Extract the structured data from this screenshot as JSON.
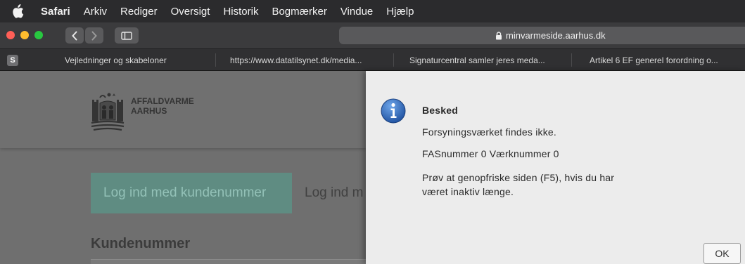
{
  "menubar": {
    "app": "Safari",
    "items": [
      "Arkiv",
      "Rediger",
      "Oversigt",
      "Historik",
      "Bogmærker",
      "Vindue",
      "Hjælp"
    ]
  },
  "toolbar": {
    "address": "minvarmeside.aarhus.dk"
  },
  "bookmarks": {
    "favicon_letter": "S",
    "items": [
      "Vejledninger og skabeloner",
      "https://www.datatilsynet.dk/media...",
      "Signaturcentral samler jeres meda...",
      "Artikel 6 EF generel forordning o..."
    ]
  },
  "page": {
    "logo_line1": "AFFALDVARME",
    "logo_line2": "AARHUS",
    "tab_active": "Log ind med kundenummer",
    "tab_inactive": "Log ind m",
    "section_title": "Kundenummer"
  },
  "dialog": {
    "title": "Besked",
    "line1": "Forsyningsværket findes ikke.",
    "line2": "FASnummer 0 Værknummer 0",
    "line3": "Prøv at genopfriske siden (F5), hvis du har",
    "line4": "været inaktiv længe.",
    "ok_label": "OK",
    "icon": "info-icon"
  },
  "colors": {
    "accent_tab": "#5f8c82",
    "traffic_red": "#ff5f57",
    "traffic_yellow": "#febc2e",
    "traffic_green": "#28c840",
    "info_blue": "#2f6fc0"
  }
}
